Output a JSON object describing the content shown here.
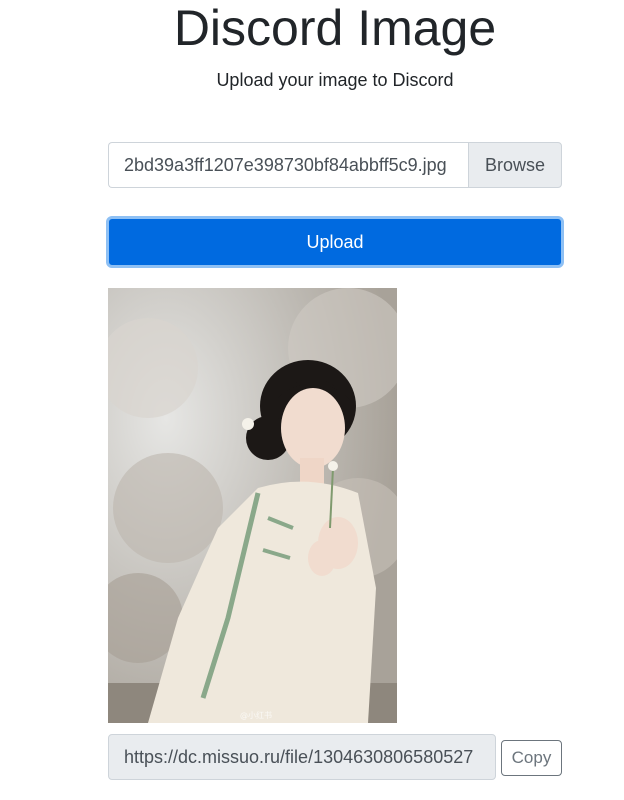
{
  "header": {
    "title": "Discord Image",
    "subtitle": "Upload your image to Discord"
  },
  "file_input": {
    "file_name": "2bd39a3ff1207e398730bf84abbff5c9.jpg",
    "browse_label": "Browse"
  },
  "upload": {
    "label": "Upload",
    "color": "#006ae0"
  },
  "preview": {
    "watermark": "@小红书"
  },
  "result": {
    "url": "https://dc.missuo.ru/file/1304630806580527",
    "copy_label": "Copy"
  }
}
